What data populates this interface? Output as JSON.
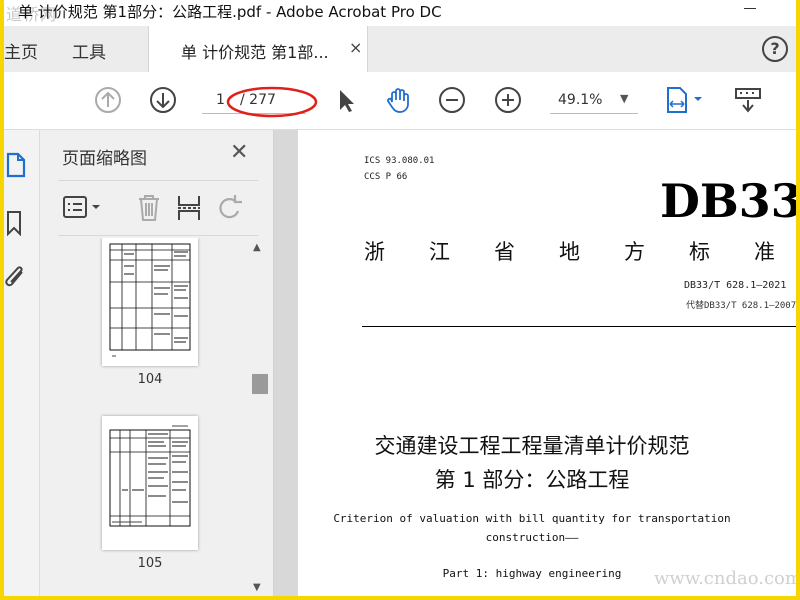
{
  "window": {
    "title": "单 计价规范 第1部分：公路工程.pdf - Adobe Acrobat Pro DC",
    "watermark_top": "道桥网",
    "watermark_bottom": "www.cndao.com"
  },
  "tabs": {
    "home": "主页",
    "tools": "工具",
    "document": "单 计价规范 第1部...",
    "close": "×",
    "help": "?"
  },
  "toolbar": {
    "page_current": "1",
    "page_total": "/ 277",
    "zoom": "49.1%",
    "annotation_color": "#e0201a",
    "accent": "#1f6fd1"
  },
  "panel": {
    "title": "页面缩略图",
    "close": "✕",
    "thumbnails": [
      {
        "label": "104"
      },
      {
        "label": "105"
      }
    ]
  },
  "document": {
    "ics": "ICS 93.080.01",
    "ccs": "CCS P 66",
    "standard_prefix": "DB33",
    "province": "浙江省地方标准",
    "code": "DB33/T 628.1—2021",
    "replaces": "代替DB33/T 628.1—2007",
    "title_line1": "交通建设工程工程量清单计价规范",
    "title_line2": "第 1 部分：公路工程",
    "english_line1": "Criterion of valuation with bill quantity for transportation",
    "english_line2": "construction——",
    "english_line3": "Part 1: highway engineering"
  }
}
